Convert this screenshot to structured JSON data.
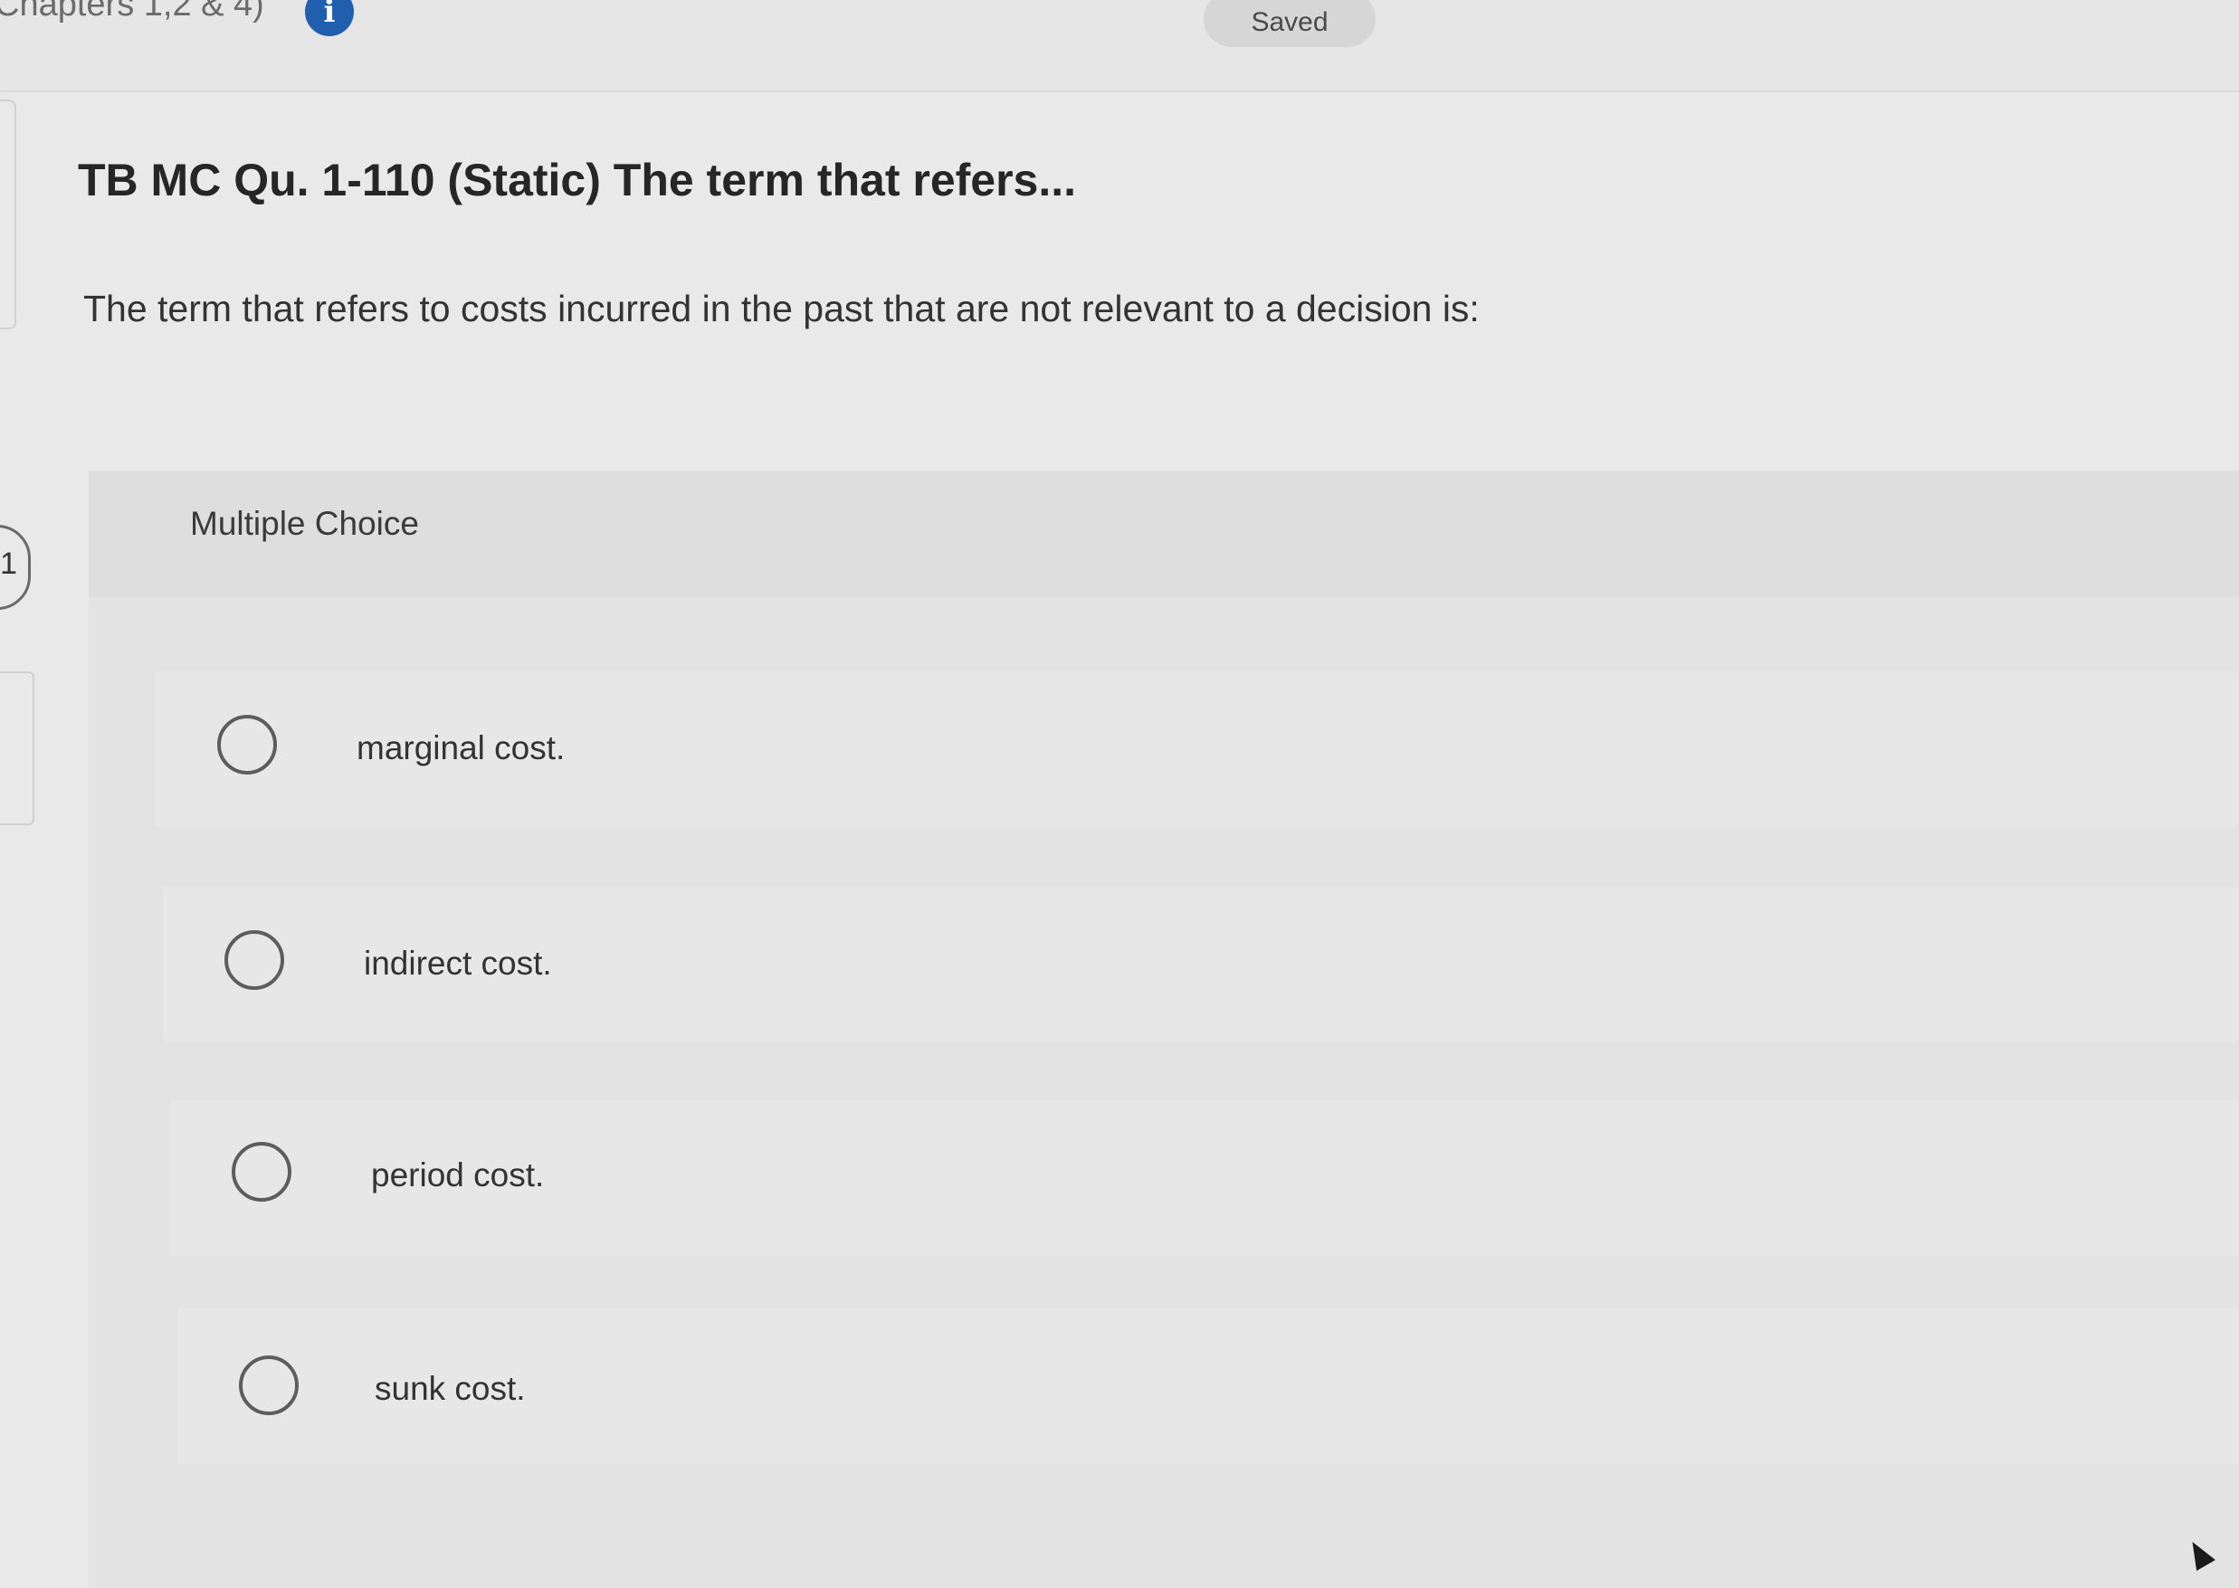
{
  "header": {
    "assignment_title": "Chapters 1,2 & 4)",
    "info_icon": "info-icon",
    "info_glyph": "i",
    "saved_label": "Saved"
  },
  "side_nav": {
    "question_number": "1"
  },
  "question": {
    "title": "TB MC Qu. 1-110 (Static) The term that refers...",
    "text": "The term that refers to costs incurred in the past that are not relevant to a decision is:"
  },
  "multiple_choice": {
    "label": "Multiple Choice",
    "options": [
      {
        "label": "marginal cost.",
        "selected": false
      },
      {
        "label": "indirect cost.",
        "selected": false
      },
      {
        "label": "period cost.",
        "selected": false
      },
      {
        "label": "sunk cost.",
        "selected": false
      }
    ]
  }
}
